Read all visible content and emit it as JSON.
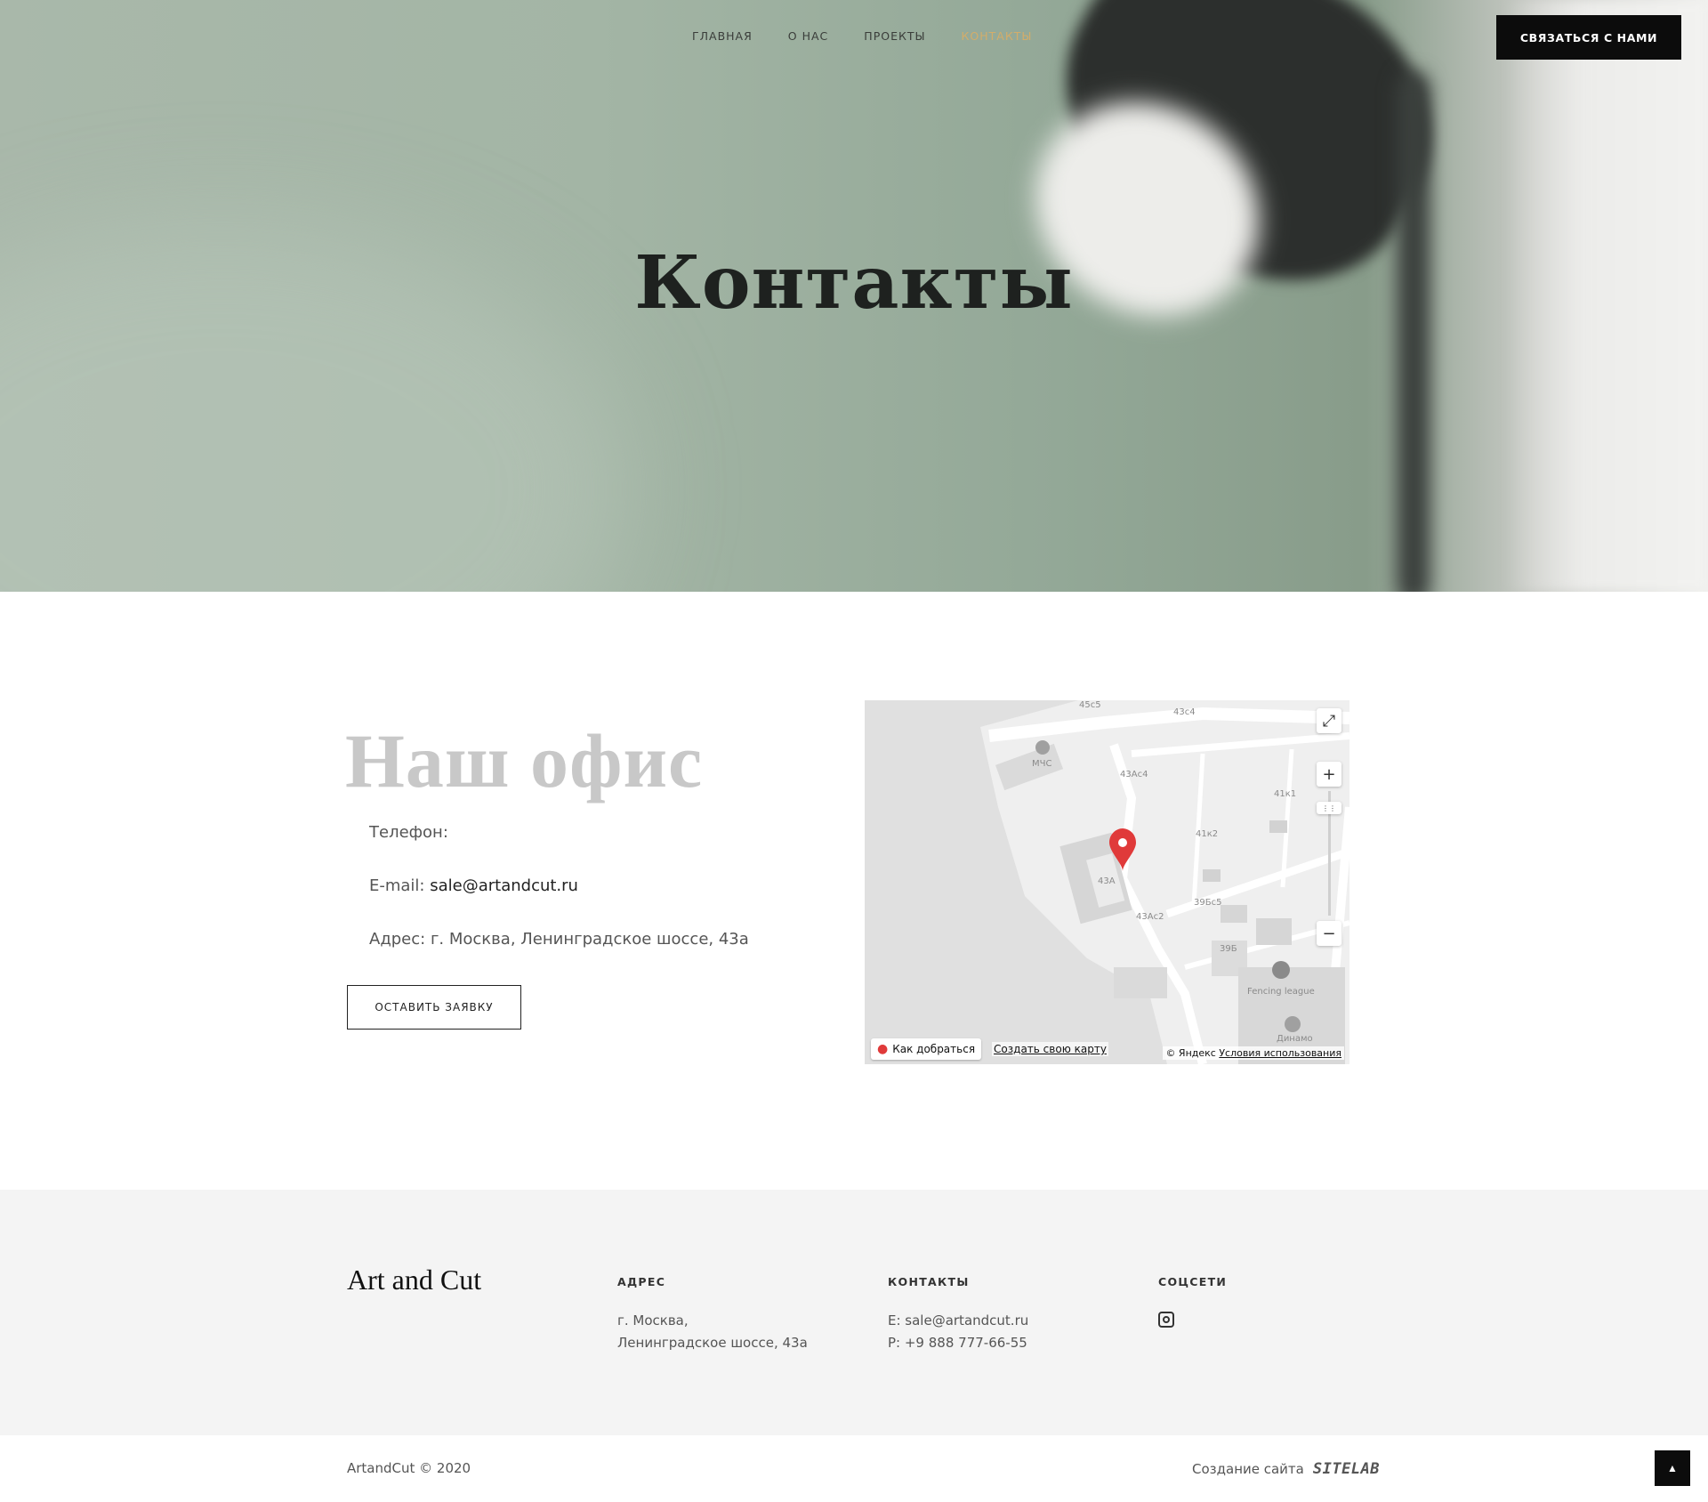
{
  "nav": {
    "items": [
      {
        "label": "ГЛАВНАЯ"
      },
      {
        "label": "О НАС"
      },
      {
        "label": "ПРОЕКТЫ"
      },
      {
        "label": "КОНТАКТЫ",
        "active": true
      }
    ],
    "cta_label": "СВЯЗАТЬСЯ С НАМИ"
  },
  "hero": {
    "title": "Контакты"
  },
  "office": {
    "title": "Наш офис",
    "phone_label": "Телефон:",
    "email_label": "E-mail:",
    "email_value": "sale@artandcut.ru",
    "address_label": "Адрес:",
    "address_value": "г. Москва, Ленинградское шоссе, 43а",
    "button_label": "ОСТАВИТЬ ЗАЯВКУ"
  },
  "map": {
    "labels": {
      "l45c5": "45с5",
      "l43c4": "43с4",
      "mchs": "МЧС",
      "l43ac4": "43Ас4",
      "l41k1": "41к1",
      "l41k2": "41к2",
      "l43a": "43А",
      "l39bc5": "39Бс5",
      "l43ac2": "43Ас2",
      "l39b": "39Б",
      "fencing": "Fencing league",
      "dinamo": "Динамо"
    },
    "route_label": "Как добраться",
    "create_label": "Создать свою карту",
    "copyright_prefix": "© Яндекс",
    "terms_label": "Условия использования"
  },
  "footer": {
    "logo": "Art and Cut",
    "address_title": "АДРЕС",
    "address_line1": "г. Москва,",
    "address_line2": "Ленинградское шоссе, 43а",
    "contacts_title": "КОНТАКТЫ",
    "contacts_email": "E: sale@artandcut.ru",
    "contacts_phone": "P: +9 888 777-66-55",
    "social_title": "СОЦСЕТИ",
    "social_icons": [
      "instagram-icon"
    ]
  },
  "bottom": {
    "copyright": "ArtandCut © 2020",
    "made_by": "Создание сайта",
    "made_by_brand": "SITELAB"
  },
  "colors": {
    "nav_active": "#d3ad6a",
    "cta_bg": "#0c0c0c",
    "office_title": "#c8c8c8",
    "footer_bg": "#f4f4f4"
  }
}
